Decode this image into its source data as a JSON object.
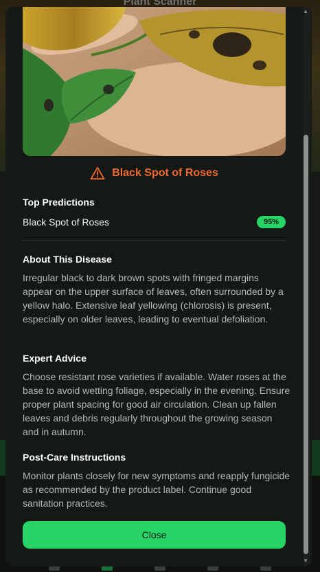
{
  "background": {
    "header_title": "Plant Scanner"
  },
  "modal": {
    "disease_title": "Black Spot of Roses",
    "top_predictions": {
      "heading": "Top Predictions",
      "items": [
        {
          "label": "Black Spot of Roses",
          "confidence": "95%"
        }
      ]
    },
    "about": {
      "heading": "About This Disease",
      "text": "Irregular black to dark brown spots with fringed margins appear on the upper surface of leaves, often surrounded by a yellow halo. Extensive leaf yellowing (chlorosis) is present, especially on older leaves, leading to eventual defoliation."
    },
    "advice": {
      "heading": "Expert Advice",
      "text": "Choose resistant rose varieties if available. Water roses at the base to avoid wetting foliage, especially in the evening. Ensure proper plant spacing for good air circulation. Clean up fallen leaves and debris regularly throughout the growing season and in autumn."
    },
    "post_care": {
      "heading": "Post-Care Instructions",
      "text": "Monitor plants closely for new symptoms and reapply fungicide as recommended by the product label. Continue good sanitation practices."
    },
    "close_label": "Close"
  },
  "colors": {
    "accent_green": "#27d466",
    "warning_orange": "#f06a2f",
    "modal_bg": "#141916"
  },
  "icons": {
    "title_icon": "warning-triangle-icon"
  }
}
